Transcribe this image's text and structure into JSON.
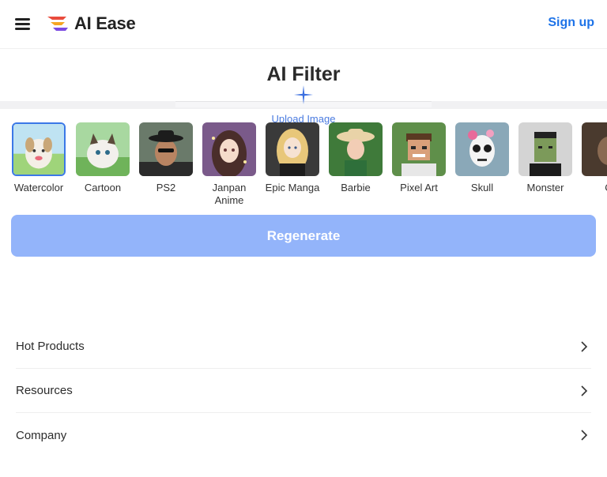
{
  "header": {
    "brand": "AI Ease",
    "signup_label": "Sign up",
    "brand_colors": [
      "#e94b3c",
      "#f5a623",
      "#7b4ae2"
    ]
  },
  "hero": {
    "title": "AI Filter",
    "upload_label": "Upload Image"
  },
  "filters": [
    {
      "label": "Watercolor",
      "selected": true,
      "icon": "watercolor-dog-thumbnail"
    },
    {
      "label": "Cartoon",
      "selected": false,
      "icon": "cartoon-cat-thumbnail"
    },
    {
      "label": "PS2",
      "selected": false,
      "icon": "ps2-man-thumbnail"
    },
    {
      "label": "Janpan Anime",
      "selected": false,
      "icon": "anime-girl-thumbnail"
    },
    {
      "label": "Epic Manga",
      "selected": false,
      "icon": "manga-girl-thumbnail"
    },
    {
      "label": "Barbie",
      "selected": false,
      "icon": "barbie-thumbnail"
    },
    {
      "label": "Pixel Art",
      "selected": false,
      "icon": "pixel-art-man-thumbnail"
    },
    {
      "label": "Skull",
      "selected": false,
      "icon": "skull-face-thumbnail"
    },
    {
      "label": "Monster",
      "selected": false,
      "icon": "monster-thumbnail"
    },
    {
      "label": "C",
      "selected": false,
      "icon": "partial-thumbnail"
    }
  ],
  "regenerate_label": "Regenerate",
  "accent_color": "#1e73e8",
  "button_color": "#93b4fa",
  "footer_nav": [
    {
      "label": "Hot Products"
    },
    {
      "label": "Resources"
    },
    {
      "label": "Company"
    }
  ]
}
